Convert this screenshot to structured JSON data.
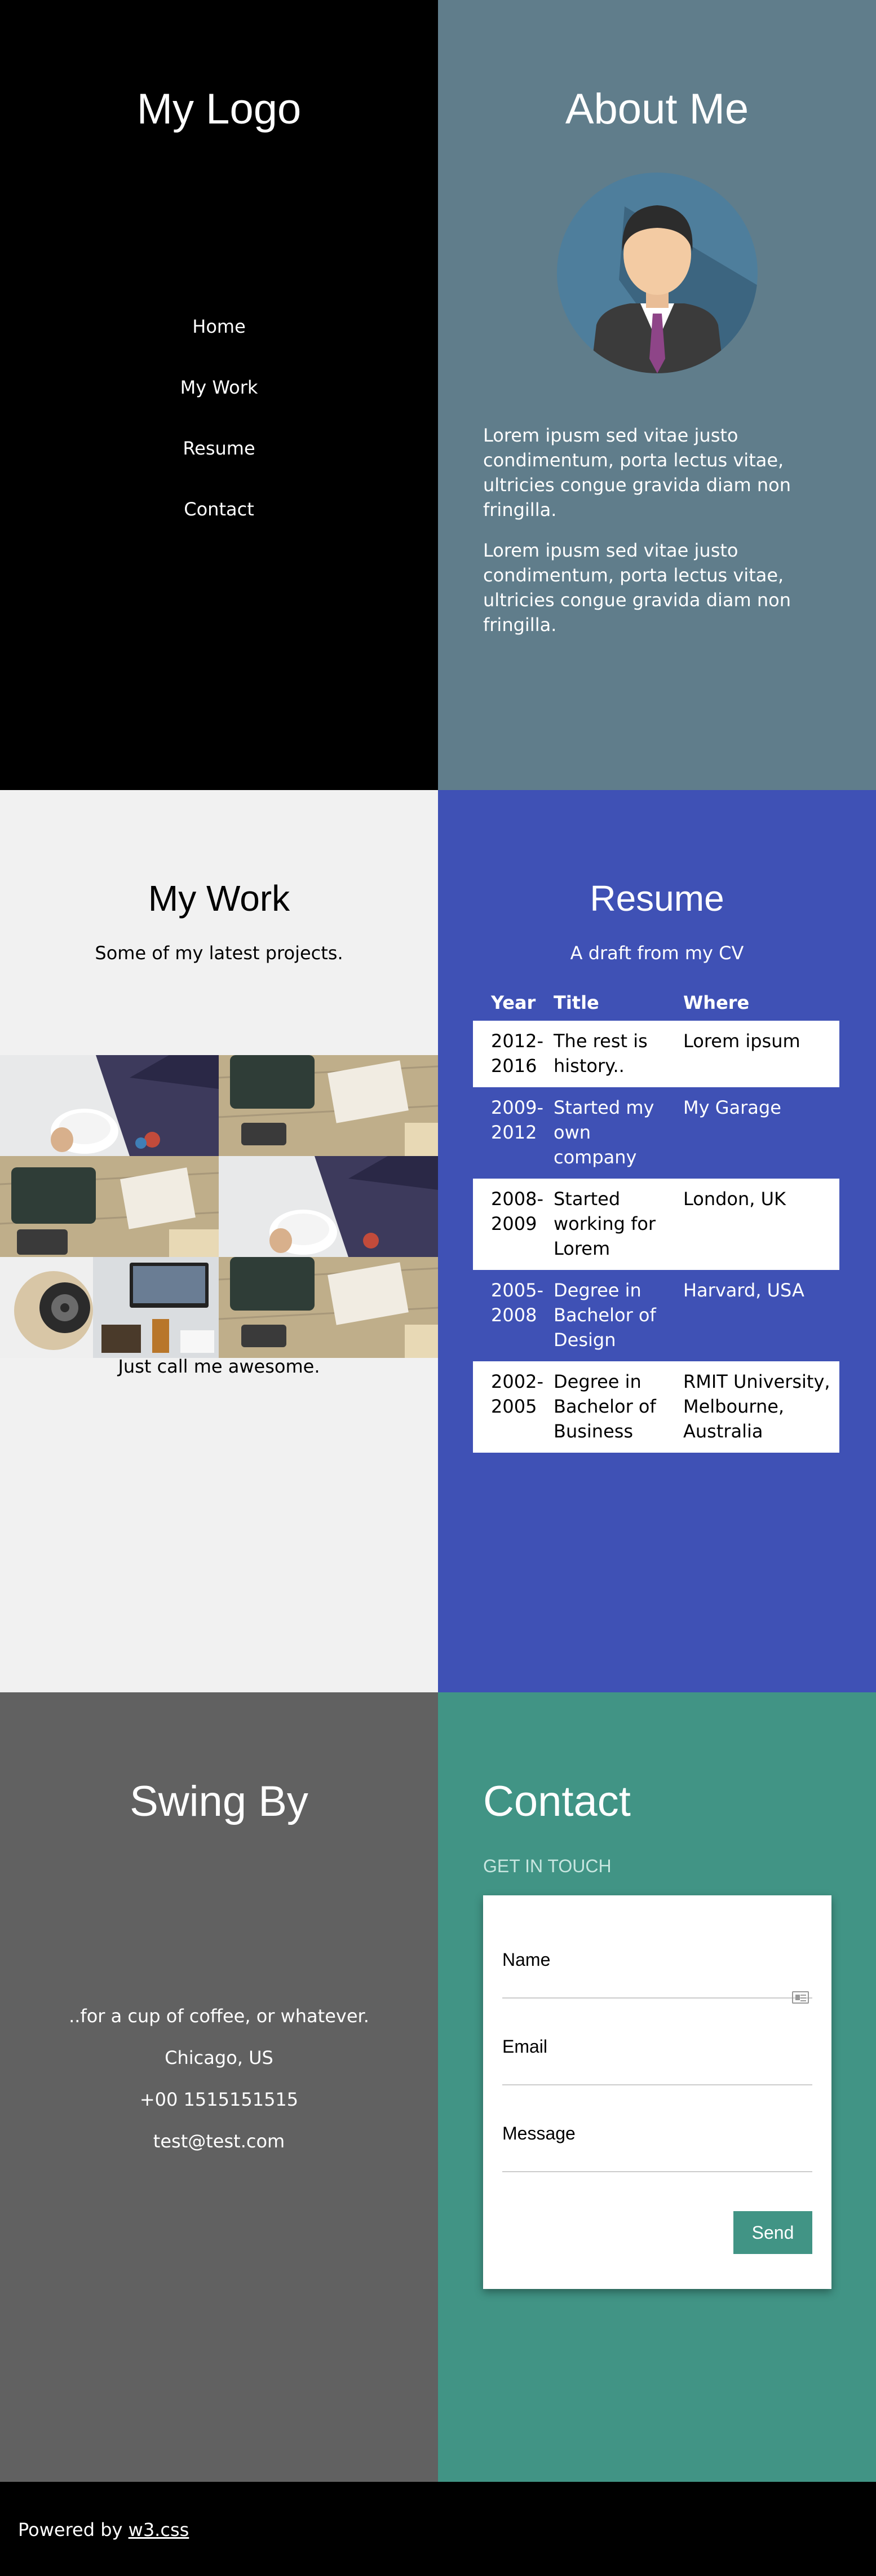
{
  "menu": {
    "logo": "My Logo",
    "nav": [
      "Home",
      "My Work",
      "Resume",
      "Contact"
    ]
  },
  "about": {
    "title": "About Me",
    "paragraphs": [
      "Lorem ipusm sed vitae justo condimentum, porta lectus vitae, ultricies congue gravida diam non fringilla.",
      "Lorem ipusm sed vitae justo condimentum, porta lectus vitae, ultricies congue gravida diam non fringilla."
    ]
  },
  "work": {
    "title": "My Work",
    "subtitle": "Some of my latest projects.",
    "footer": "Just call me awesome."
  },
  "resume": {
    "title": "Resume",
    "subtitle": "A draft from my CV",
    "headers": [
      "Year",
      "Title",
      "Where"
    ],
    "rows": [
      [
        "2012-2016",
        "The rest is history..",
        "Lorem ipsum"
      ],
      [
        "2009-2012",
        "Started my own company",
        "My Garage"
      ],
      [
        "2008-2009",
        "Started working for Lorem",
        "London, UK"
      ],
      [
        "2005-2008",
        "Degree in Bachelor of Design",
        "Harvard, USA"
      ],
      [
        "2002-2005",
        "Degree in Bachelor of Business",
        "RMIT University, Melbourne, Australia"
      ]
    ]
  },
  "swing": {
    "title": "Swing By",
    "lines": [
      "..for a cup of coffee, or whatever.",
      "Chicago, US",
      "+00 1515151515",
      "test@test.com"
    ]
  },
  "contact": {
    "title": "Contact",
    "subtitle": "GET IN TOUCH",
    "name_label": "Name",
    "email_label": "Email",
    "message_label": "Message",
    "send_label": "Send"
  },
  "footer": {
    "prefix": "Powered by ",
    "link": "w3.css"
  },
  "colors": {
    "about_bg": "#607d8b",
    "resume_bg": "#3f51b5",
    "swing_bg": "#616161",
    "contact_bg": "#419485"
  }
}
